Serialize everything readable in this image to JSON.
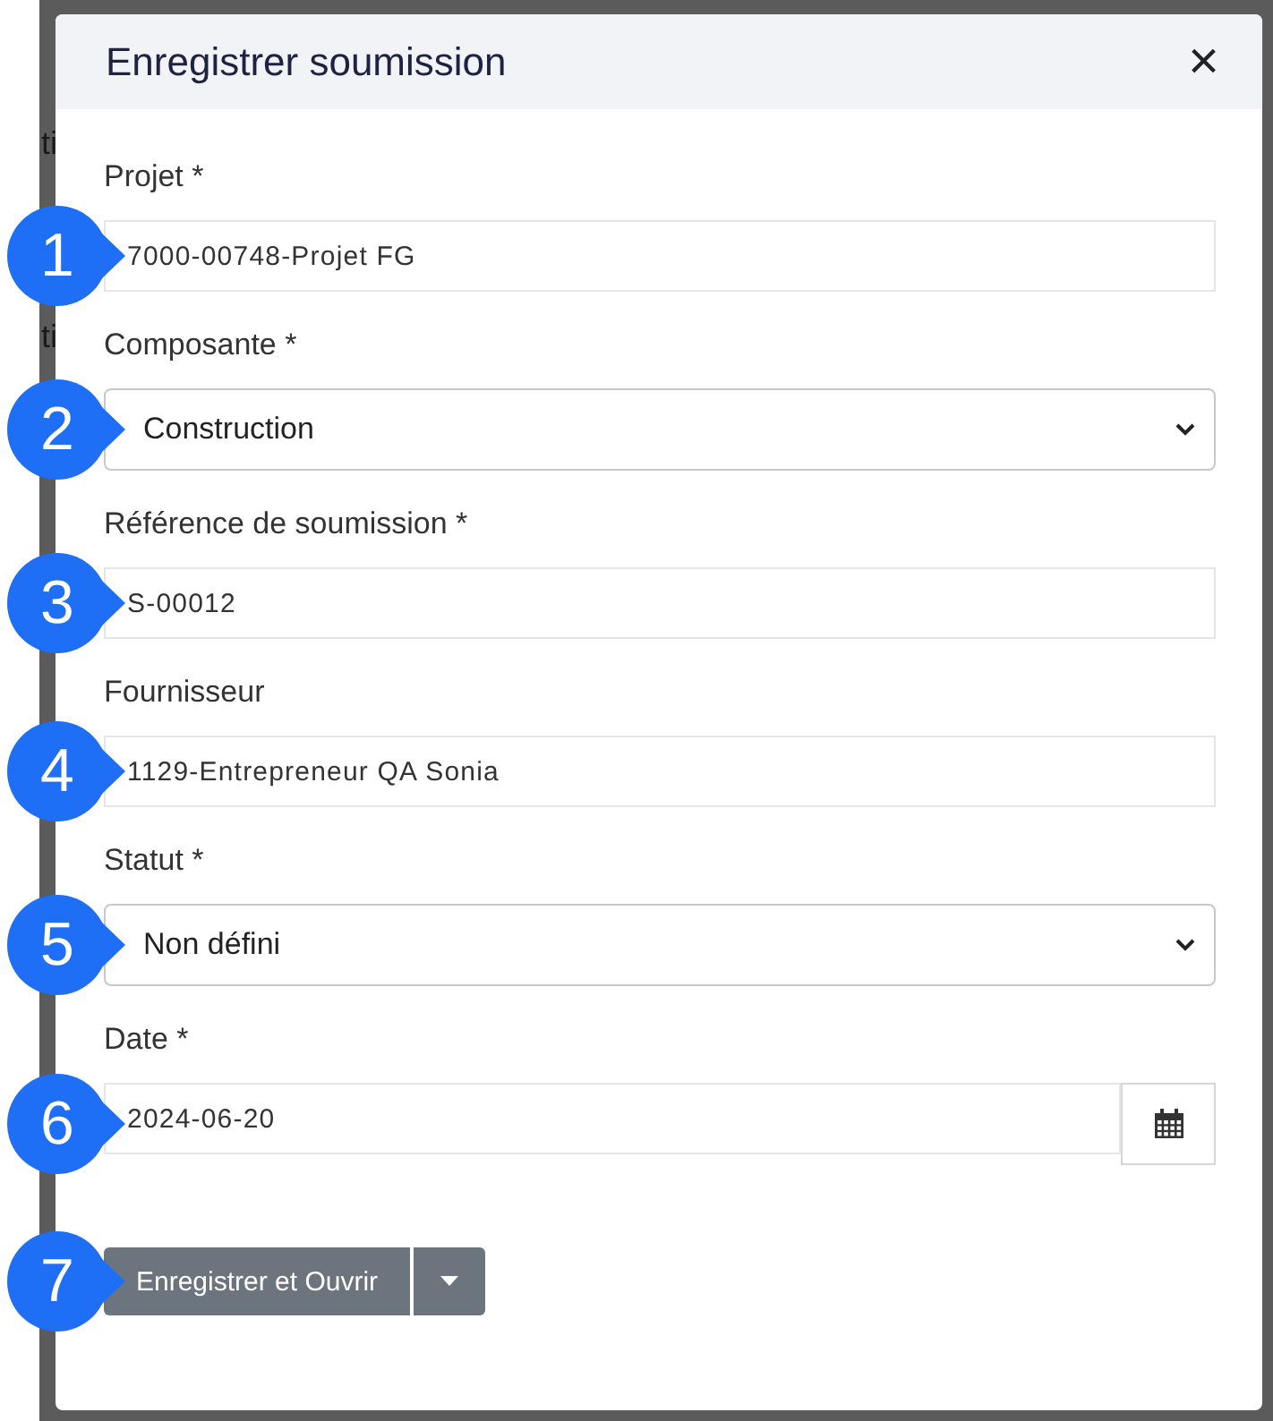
{
  "background_texts": [
    "ti",
    "ti"
  ],
  "dialog": {
    "title": "Enregistrer soumission",
    "close_label": "×",
    "fields": [
      {
        "kind": "input",
        "label": "Projet *",
        "value": "7000-00748-Projet FG",
        "callout": "1"
      },
      {
        "kind": "select",
        "label": "Composante *",
        "value": "Construction",
        "callout": "2"
      },
      {
        "kind": "input",
        "label": "Référence de soumission *",
        "value": "S-00012",
        "callout": "3"
      },
      {
        "kind": "input",
        "label": "Fournisseur",
        "value": "1129-Entrepreneur QA Sonia",
        "callout": "4"
      },
      {
        "kind": "select",
        "label": "Statut *",
        "value": "Non défini",
        "callout": "5"
      },
      {
        "kind": "date",
        "label": "Date *",
        "value": "2024-06-20",
        "callout": "6"
      }
    ],
    "save_button": {
      "label": "Enregistrer et Ouvrir",
      "callout": "7"
    }
  }
}
